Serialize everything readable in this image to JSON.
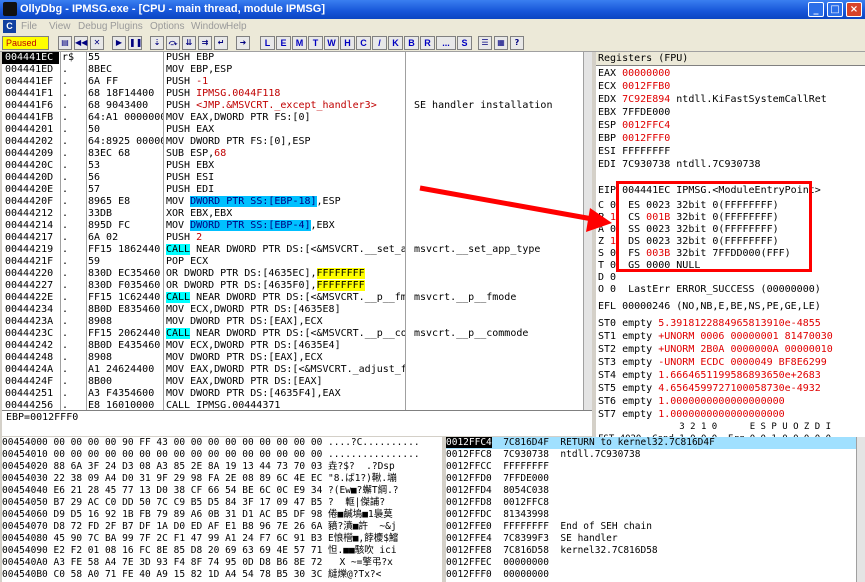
{
  "window": {
    "title": "OllyDbg - IPMSG.exe - [CPU - main thread, module IPMSG]",
    "buttons": [
      "_",
      "□",
      "×"
    ]
  },
  "menu": [
    "File",
    "View",
    "Debug",
    "Plugins",
    "Options",
    "Window",
    "Help"
  ],
  "toolbar": {
    "status": "Paused",
    "letters": [
      "L",
      "E",
      "M",
      "T",
      "W",
      "H",
      "C",
      "/",
      "K",
      "B",
      "R",
      "...",
      "S"
    ]
  },
  "cpu_rows": [
    {
      "addr": "004441EC",
      "mark": "r$",
      "hex": "55",
      "asm": "PUSH EBP",
      "com": ""
    },
    {
      "addr": "004441ED",
      "mark": ".",
      "hex": "8BEC",
      "asm": "MOV EBP,ESP",
      "com": ""
    },
    {
      "addr": "004441EF",
      "mark": ".",
      "hex": "6A FF",
      "asm": "PUSH -1",
      "com": ""
    },
    {
      "addr": "004441F1",
      "mark": ".",
      "hex": "68 18F14400",
      "asm": "PUSH IPMSG.0044F118",
      "com": ""
    },
    {
      "addr": "004441F6",
      "mark": ".",
      "hex": "68 9043400",
      "asm": "PUSH <JMP.&MSVCRT._except_handler3>",
      "com": "SE handler installation"
    },
    {
      "addr": "004441FB",
      "mark": ".",
      "hex": "64:A1 0000000",
      "asm": "MOV EAX,DWORD PTR FS:[0]",
      "com": ""
    },
    {
      "addr": "00444201",
      "mark": ".",
      "hex": "50",
      "asm": "PUSH EAX",
      "com": ""
    },
    {
      "addr": "00444202",
      "mark": ".",
      "hex": "64:8925 00000",
      "asm": "MOV DWORD PTR FS:[0],ESP",
      "com": ""
    },
    {
      "addr": "00444209",
      "mark": ".",
      "hex": "83EC 68",
      "asm": "SUB ESP,68",
      "com": ""
    },
    {
      "addr": "0044420C",
      "mark": ".",
      "hex": "53",
      "asm": "PUSH EBX",
      "com": ""
    },
    {
      "addr": "0044420D",
      "mark": ".",
      "hex": "56",
      "asm": "PUSH ESI",
      "com": ""
    },
    {
      "addr": "0044420E",
      "mark": ".",
      "hex": "57",
      "asm": "PUSH EDI",
      "com": ""
    },
    {
      "addr": "0044420F",
      "mark": ".",
      "hex": "8965 E8",
      "asm": "MOV DWORD PTR SS:[EBP-18],ESP",
      "com": ""
    },
    {
      "addr": "00444212",
      "mark": ".",
      "hex": "33DB",
      "asm": "XOR EBX,EBX",
      "com": ""
    },
    {
      "addr": "00444214",
      "mark": ".",
      "hex": "895D FC",
      "asm": "MOV DWORD PTR SS:[EBP-4],EBX",
      "com": ""
    },
    {
      "addr": "00444217",
      "mark": ".",
      "hex": "6A 02",
      "asm": "PUSH 2",
      "com": ""
    },
    {
      "addr": "00444219",
      "mark": ".",
      "hex": "FF15 1862440",
      "asm": "CALL NEAR DWORD PTR DS:[<&MSVCRT.__set_a",
      "com": "msvcrt.__set_app_type"
    },
    {
      "addr": "0044421F",
      "mark": ".",
      "hex": "59",
      "asm": "POP ECX",
      "com": ""
    },
    {
      "addr": "00444220",
      "mark": ".",
      "hex": "830D EC35460",
      "asm": "OR DWORD PTR DS:[4635EC],FFFFFFFF",
      "com": ""
    },
    {
      "addr": "00444227",
      "mark": ".",
      "hex": "830D F035460",
      "asm": "OR DWORD PTR DS:[4635F0],FFFFFFFF",
      "com": ""
    },
    {
      "addr": "0044422E",
      "mark": ".",
      "hex": "FF15 1C62440",
      "asm": "CALL NEAR DWORD PTR DS:[<&MSVCRT.__p__fm",
      "com": "msvcrt.__p__fmode"
    },
    {
      "addr": "00444234",
      "mark": ".",
      "hex": "8B0D E835460",
      "asm": "MOV ECX,DWORD PTR DS:[4635E8]",
      "com": ""
    },
    {
      "addr": "0044423A",
      "mark": ".",
      "hex": "8908",
      "asm": "MOV DWORD PTR DS:[EAX],ECX",
      "com": ""
    },
    {
      "addr": "0044423C",
      "mark": ".",
      "hex": "FF15 2062440",
      "asm": "CALL NEAR DWORD PTR DS:[<&MSVCRT.__p__co",
      "com": "msvcrt.__p__commode"
    },
    {
      "addr": "00444242",
      "mark": ".",
      "hex": "8B0D E435460",
      "asm": "MOV ECX,DWORD PTR DS:[4635E4]",
      "com": ""
    },
    {
      "addr": "00444248",
      "mark": ".",
      "hex": "8908",
      "asm": "MOV DWORD PTR DS:[EAX],ECX",
      "com": ""
    },
    {
      "addr": "0044424A",
      "mark": ".",
      "hex": "A1 24624400",
      "asm": "MOV EAX,DWORD PTR DS:[<&MSVCRT._adjust_f",
      "com": ""
    },
    {
      "addr": "0044424F",
      "mark": ".",
      "hex": "8B00",
      "asm": "MOV EAX,DWORD PTR DS:[EAX]",
      "com": ""
    },
    {
      "addr": "00444251",
      "mark": ".",
      "hex": "A3 F4354600",
      "asm": "MOV DWORD PTR DS:[4635F4],EAX",
      "com": ""
    },
    {
      "addr": "00444256",
      "mark": ".",
      "hex": "E8 16010000",
      "asm": "CALL IPMSG.00444371",
      "com": ""
    }
  ],
  "info_line": "EBP=0012FFF0",
  "registers": {
    "header": "Registers (FPU)",
    "lines": [
      {
        "name": "EAX",
        "val": "00000000",
        "com": "",
        "red": true
      },
      {
        "name": "ECX",
        "val": "0012FFB0",
        "com": "",
        "red": true
      },
      {
        "name": "EDX",
        "val": "7C92E894",
        "com": "ntdll.KiFastSystemCallRet",
        "red": true
      },
      {
        "name": "EBX",
        "val": "7FFDE000",
        "com": "",
        "red": false
      },
      {
        "name": "ESP",
        "val": "0012FFC4",
        "com": "",
        "red": true
      },
      {
        "name": "EBP",
        "val": "0012FFF0",
        "com": "",
        "red": true
      },
      {
        "name": "ESI",
        "val": "FFFFFFFF",
        "com": "",
        "red": false
      },
      {
        "name": "EDI",
        "val": "7C930738",
        "com": "ntdll.7C930738",
        "red": false
      },
      {
        "name": "",
        "val": "",
        "com": "",
        "red": false
      },
      {
        "name": "EIP",
        "val": "004441EC",
        "com": "IPMSG.<ModuleEntryPoint>",
        "red": false
      }
    ],
    "flags": [
      {
        "f": "C",
        "v": "0",
        "seg": "ES",
        "sel": "0023",
        "desc": "32bit 0(FFFFFFFF)"
      },
      {
        "f": "P",
        "v": "1",
        "seg": "CS",
        "sel": "001B",
        "desc": "32bit 0(FFFFFFFF)"
      },
      {
        "f": "A",
        "v": "0",
        "seg": "SS",
        "sel": "0023",
        "desc": "32bit 0(FFFFFFFF)"
      },
      {
        "f": "Z",
        "v": "1",
        "seg": "DS",
        "sel": "0023",
        "desc": "32bit 0(FFFFFFFF)"
      },
      {
        "f": "S",
        "v": "0",
        "seg": "FS",
        "sel": "003B",
        "desc": "32bit 7FFDD000(FFF)"
      },
      {
        "f": "T",
        "v": "0",
        "seg": "GS",
        "sel": "0000",
        "desc": "NULL"
      },
      {
        "f": "D",
        "v": "0",
        "seg": "",
        "sel": "",
        "desc": ""
      },
      {
        "f": "O",
        "v": "0",
        "seg": "",
        "sel": "",
        "desc": "LastErr ERROR_SUCCESS (00000000)"
      }
    ],
    "efl": "EFL 00000246 (NO,NB,E,BE,NS,PE,GE,LE)",
    "fpu": [
      "ST0 empty 5.3918122884965813910e-4855",
      "ST1 empty +UNORM 0006 00000001 81470030",
      "ST2 empty +UNORM 2B0A 0000000A 00000010",
      "ST3 empty -UNORM ECDC 0000049 BF8E6299",
      "ST4 empty 1.6664651199586893650e+2683",
      "ST5 empty 4.6564599727100058730e-4932",
      "ST6 empty 1.0000000000000000000",
      "ST7 empty 1.0000000000000000000"
    ],
    "fst_hdr": "               3 2 1 0      E S P U O Z D I",
    "fst": "FST 4020  Cond 1 0 0 0  Err 0 0 1 0 0 0 0 0",
    "fcw": "FCW 027F  Prec NEAR,53  Mask    1 1 1 1 1 1"
  },
  "dump_rows": [
    {
      "addr": "00454000",
      "hex": "00 00 00 00 90 FF 43 00 00 00 00 00 00 00 00 00",
      "ascii": "....?C.........."
    },
    {
      "addr": "00454010",
      "hex": "00 00 00 00 00 00 00 00 00 00 00 00 00 00 00 00",
      "ascii": "................"
    },
    {
      "addr": "00454020",
      "hex": "88 6A 3F 24 D3 08 A3 85 2E 8A 19 13 44 73 70 03",
      "ascii": "垚?$?  .?Dsp"
    },
    {
      "addr": "00454030",
      "hex": "22 38 09 A4 D0 31 9F 29 98 FA 2E 08 89 6C 4E EC",
      "ascii": "\"8.ば1?)鞦.塴"
    },
    {
      "addr": "00454040",
      "hex": "E6 21 28 45 77 13 D0 38 CF 66 54 BE 6C 0C E9 34",
      "ascii": "?(Ew■?蠏T綱.?"
    },
    {
      "addr": "00454050",
      "hex": "B7 29 AC C0 DD 50 7C C9 B5 D5 84 3F 17 09 47 B5",
      "ascii": "?  軭|傑誧?"
    },
    {
      "addr": "00454060",
      "hex": "D9 D5 16 92 1B FB 79 89 A6 0B 31 D1 AC B5 DF 98",
      "ascii": "倦■鹹塢■1裊莫"
    },
    {
      "addr": "00454070",
      "hex": "D8 72 FD 2F B7 DF 1A D0 ED AF E1 B8 96 7E 26 6A",
      "ascii": "豶?濆■許  ~&j"
    },
    {
      "addr": "00454080",
      "hex": "45 90 7C BA 99 7F 2C F1 47 99 A1 24 F7 6C 91 B3",
      "ascii": "E悢櫿■,餑櫦$鱨"
    },
    {
      "addr": "00454090",
      "hex": "E2 F2 01 08 16 FC 8E 85 D8 20 69 63 69 4E 57 71",
      "ascii": "怛.■■駭吹 ici"
    },
    {
      "addr": "004540A0",
      "hex": "A3 FE 58 A4 7E 3D 93 F4 8F 74 95 0D D8 B6 8E 72",
      "ascii": "  X ~=擎弔?x"
    },
    {
      "addr": "004540B0",
      "hex": "C0 58 A0 71 FE 40 A9 15 82 1D A4 54 78 B5 30 3C",
      "ascii": "繨爍@?Tx?<"
    }
  ],
  "stack_rows": [
    {
      "addr": "0012FFC4",
      "val": "7C816D4F",
      "com": "RETURN to kernel32.7C816D4F",
      "sel": true
    },
    {
      "addr": "0012FFC8",
      "val": "7C930738",
      "com": "ntdll.7C930738",
      "sel": false
    },
    {
      "addr": "0012FFCC",
      "val": "FFFFFFFF",
      "com": "",
      "sel": false
    },
    {
      "addr": "0012FFD0",
      "val": "7FFDE000",
      "com": "",
      "sel": false
    },
    {
      "addr": "0012FFD4",
      "val": "8054C038",
      "com": "",
      "sel": false
    },
    {
      "addr": "0012FFD8",
      "val": "0012FFC8",
      "com": "",
      "sel": false
    },
    {
      "addr": "0012FFDC",
      "val": "81343998",
      "com": "",
      "sel": false
    },
    {
      "addr": "0012FFE0",
      "val": "FFFFFFFF",
      "com": "End of SEH chain",
      "sel": false
    },
    {
      "addr": "0012FFE4",
      "val": "7C8399F3",
      "com": "SE handler",
      "sel": false
    },
    {
      "addr": "0012FFE8",
      "val": "7C816D58",
      "com": "kernel32.7C816D58",
      "sel": false
    },
    {
      "addr": "0012FFEC",
      "val": "00000000",
      "com": "",
      "sel": false
    },
    {
      "addr": "0012FFF0",
      "val": "00000000",
      "com": "",
      "sel": false
    }
  ],
  "colors": {
    "accent": "#ff0000",
    "titlebar": "#1655d8",
    "selection": "#000000",
    "highlight": "#00ffff"
  }
}
